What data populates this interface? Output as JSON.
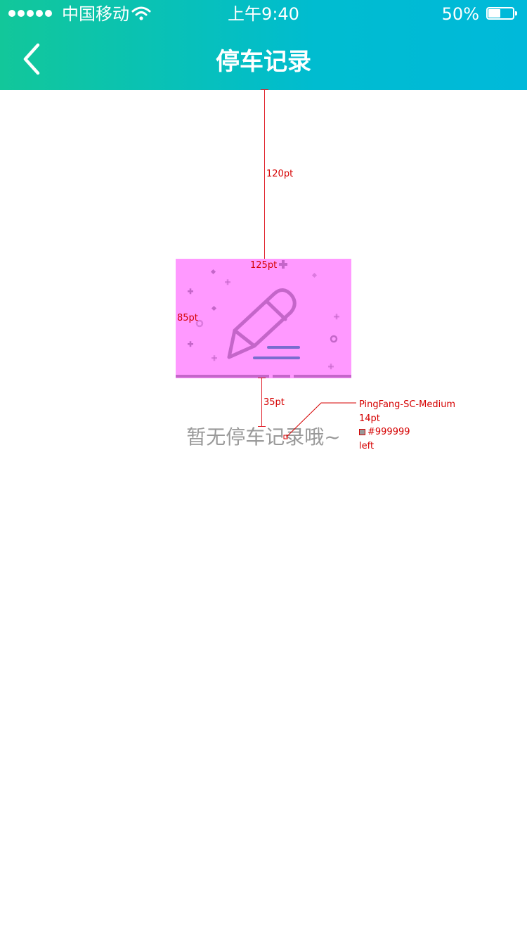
{
  "status_bar": {
    "carrier": "中国移动",
    "time": "上午9:40",
    "battery_percent": "50%",
    "battery_level": 0.5,
    "signal_bars": 5
  },
  "nav": {
    "title": "停车记录",
    "back_icon": "chevron-left-icon"
  },
  "empty_state": {
    "icon": "pencil-edit-icon",
    "message": "暂无停车记录哦~"
  },
  "annotations": {
    "top_gap": "120pt",
    "illustration_width": "125pt",
    "illustration_height": "85pt",
    "text_gap": "35pt",
    "text_spec": {
      "font": "PingFang-SC-Medium",
      "size": "14pt",
      "color": "#999999",
      "align": "left"
    }
  },
  "colors": {
    "header_gradient_start": "#12c79a",
    "header_gradient_end": "#00b9da",
    "illustration_bg": "#ff99ff",
    "icon_stroke": "#c466c9",
    "text_secondary": "#999999",
    "annotation": "#d50000"
  }
}
